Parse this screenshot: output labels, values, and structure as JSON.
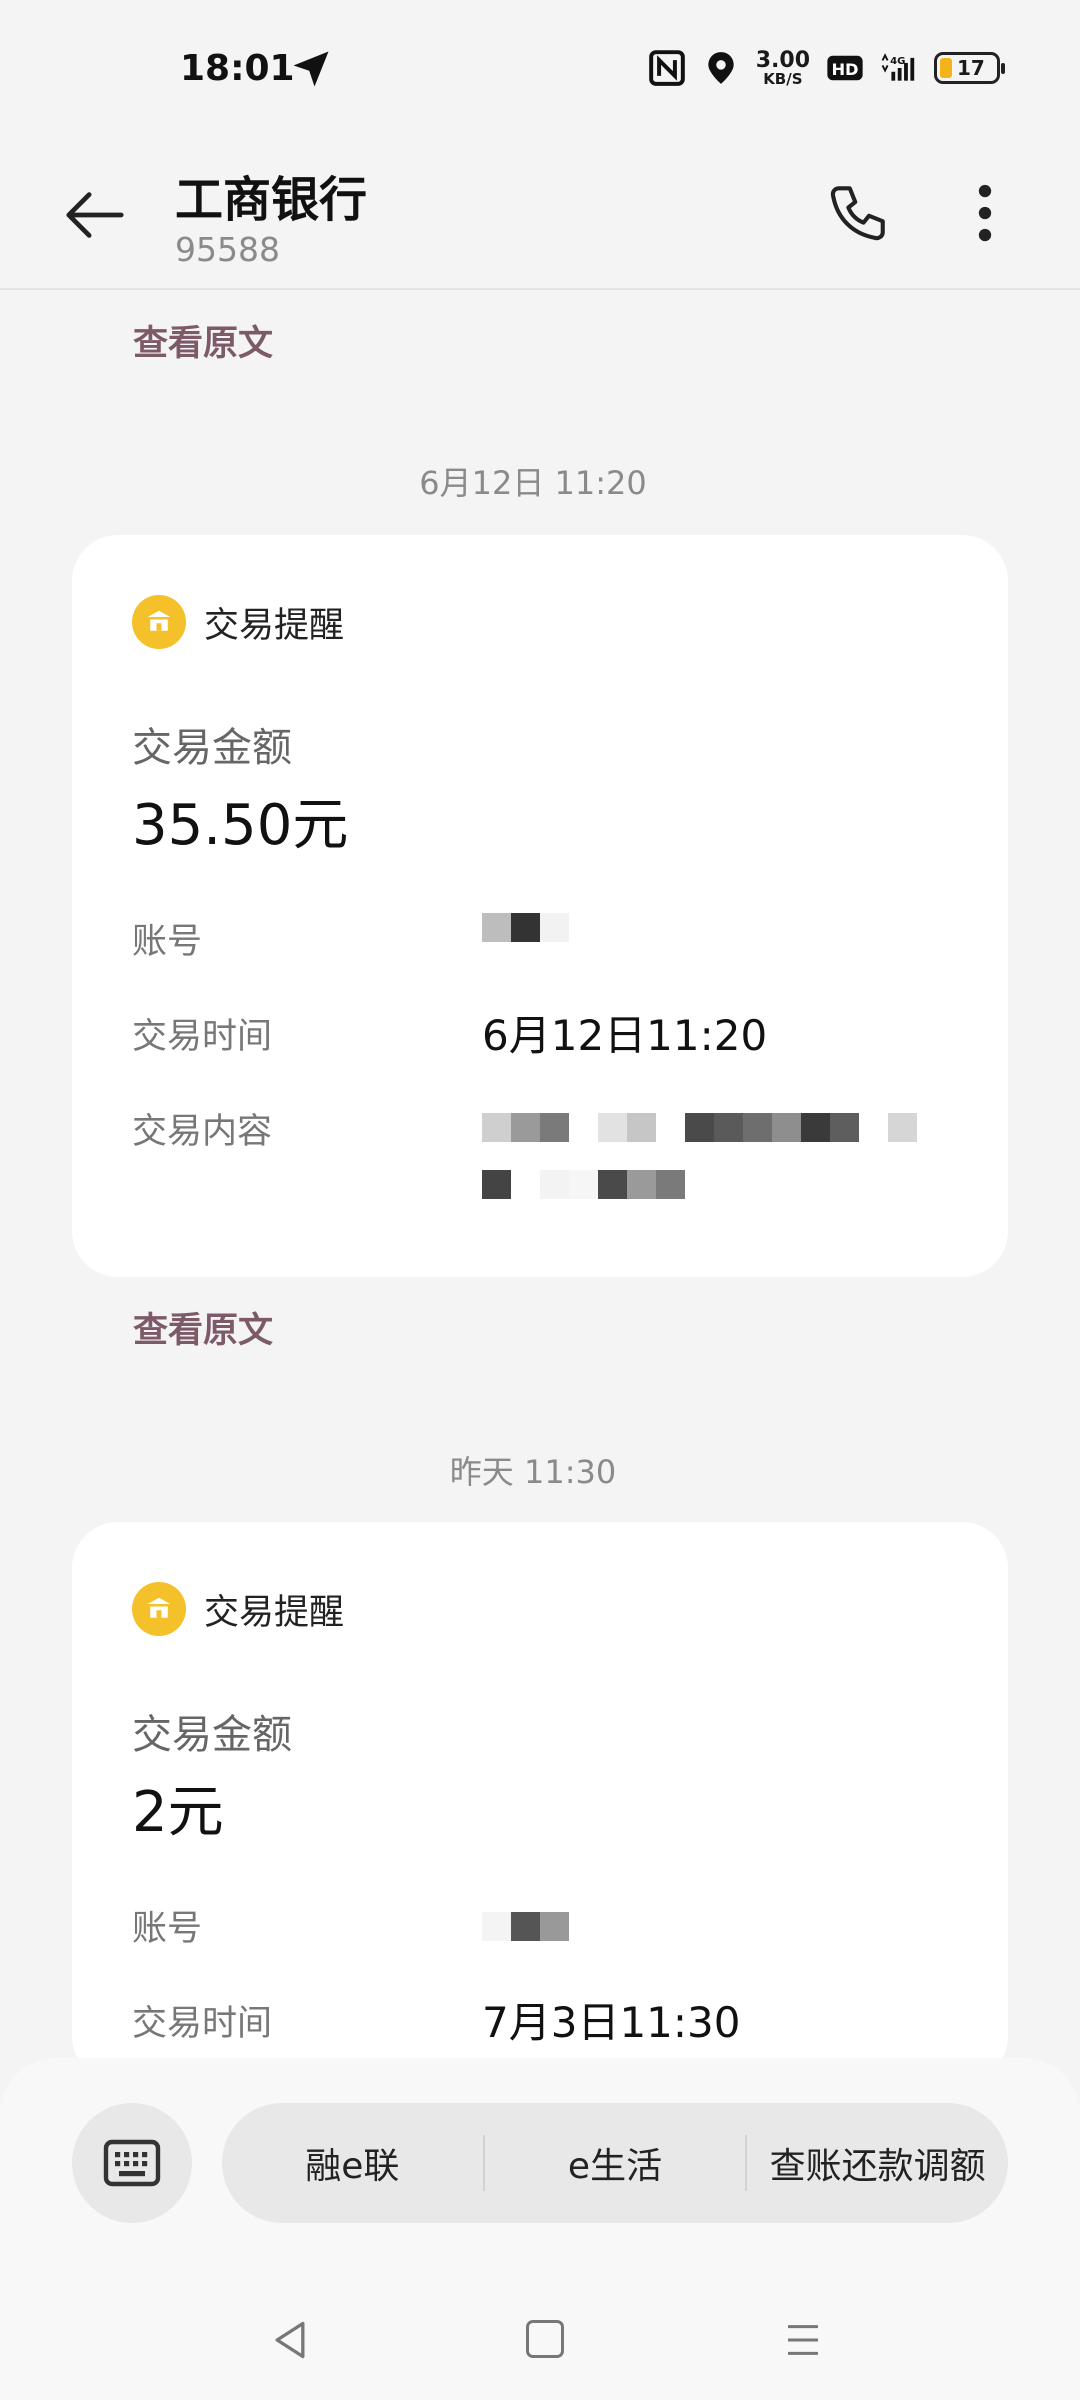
{
  "status_bar": {
    "time": "18:01",
    "net_speed_value": "3.00",
    "net_speed_unit": "KB/S",
    "hd_label": "HD",
    "network_type": "4G",
    "battery_level": "17",
    "battery_color": "#f2b418"
  },
  "header": {
    "title": "工商银行",
    "subtitle": "95588"
  },
  "view_original_label": "查看原文",
  "messages": [
    {
      "timestamp": "6月12日 11:20",
      "card_type": "交易提醒",
      "amount_label": "交易金额",
      "amount": "35.50元",
      "account_label": "账号",
      "time_label": "交易时间",
      "time_value": "6月12日11:20",
      "content_label": "交易内容"
    },
    {
      "timestamp": "昨天 11:30",
      "card_type": "交易提醒",
      "amount_label": "交易金额",
      "amount": "2元",
      "account_label": "账号",
      "time_label": "交易时间",
      "time_value": "7月3日11:30"
    }
  ],
  "quick_menu": [
    "融e联",
    "e生活",
    "查账还款调额"
  ],
  "icons": {
    "back": "arrow-left-icon",
    "call": "phone-icon",
    "more": "more-vertical-icon",
    "bank": "bank-icon",
    "keyboard": "keyboard-icon"
  },
  "colors": {
    "accent_link": "#7d5a68",
    "bank_badge": "#f5c12a",
    "background": "#f4f4f4",
    "card": "#ffffff"
  }
}
